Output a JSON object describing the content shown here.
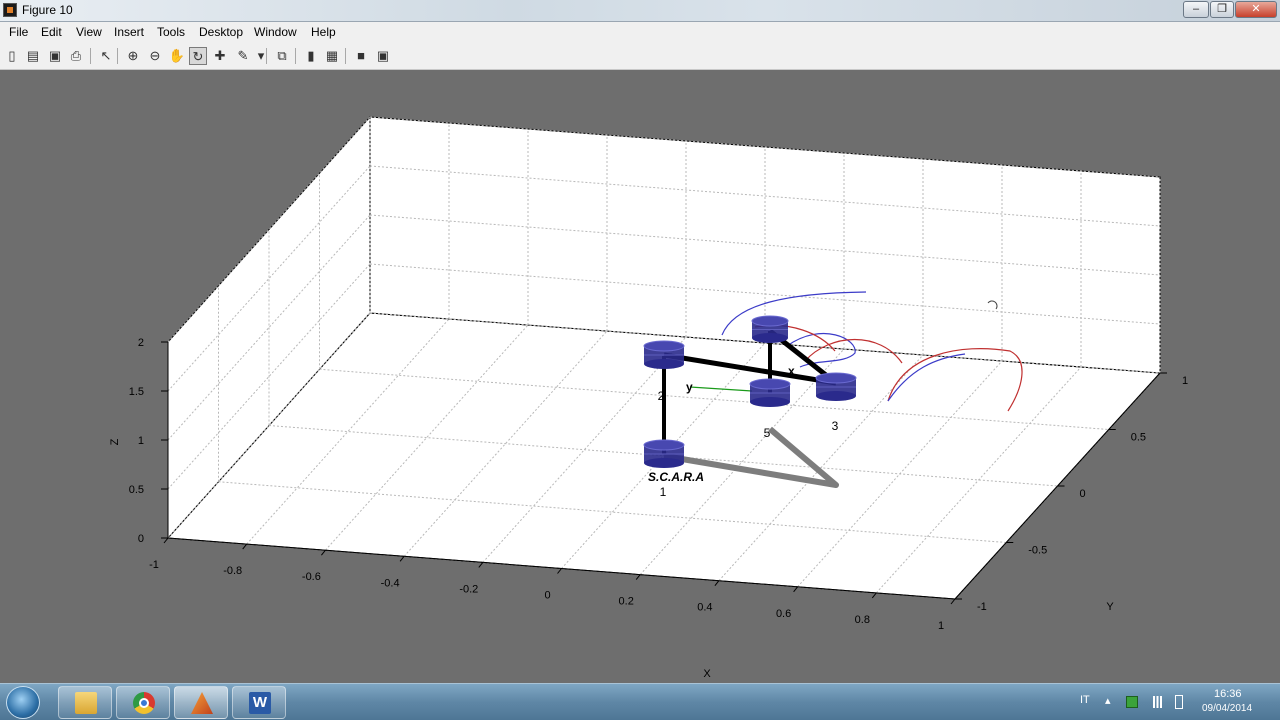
{
  "window": {
    "title": "Figure 10",
    "minimize_glyph": "–",
    "maximize_glyph": "❐",
    "close_glyph": "✕"
  },
  "menu": [
    "File",
    "Edit",
    "View",
    "Insert",
    "Tools",
    "Desktop",
    "Window",
    "Help"
  ],
  "toolbar": [
    {
      "name": "new-figure-icon",
      "glyph": "▯"
    },
    {
      "name": "open-file-icon",
      "glyph": "▤"
    },
    {
      "name": "save-icon",
      "glyph": "▣"
    },
    {
      "name": "print-icon",
      "glyph": "⎙"
    },
    {
      "name": "select-arrow-icon",
      "glyph": "↖"
    },
    {
      "name": "zoom-in-icon",
      "glyph": "⊕"
    },
    {
      "name": "zoom-out-icon",
      "glyph": "⊖"
    },
    {
      "name": "pan-hand-icon",
      "glyph": "✋"
    },
    {
      "name": "rotate-3d-icon",
      "glyph": "↻"
    },
    {
      "name": "data-cursor-icon",
      "glyph": "✚"
    },
    {
      "name": "brush-icon",
      "glyph": "✎"
    },
    {
      "name": "brush-dropdown-icon",
      "glyph": "▾"
    },
    {
      "name": "link-plot-icon",
      "glyph": "⧉"
    },
    {
      "name": "colorbar-icon",
      "glyph": "▮"
    },
    {
      "name": "legend-icon",
      "glyph": "▦"
    },
    {
      "name": "hide-plot-tools-icon",
      "glyph": "■"
    },
    {
      "name": "show-plot-tools-icon",
      "glyph": "▣"
    }
  ],
  "chart_data": {
    "type": "3d-scene",
    "xlabel": "X",
    "ylabel": "Y",
    "zlabel": "Z",
    "xlim": [
      -1,
      1
    ],
    "ylim": [
      -1,
      1
    ],
    "zlim": [
      0,
      2
    ],
    "xticks": [
      "-1",
      "-0.8",
      "-0.6",
      "-0.4",
      "-0.2",
      "0",
      "0.2",
      "0.4",
      "0.6",
      "0.8",
      "1"
    ],
    "yticks": [
      "-1",
      "-0.5",
      "0",
      "0.5",
      "1"
    ],
    "zticks": [
      "0",
      "0.5",
      "1",
      "1.5",
      "2"
    ],
    "grid": true,
    "robot_label": "S.C.A.R.A",
    "joint_labels": [
      "1",
      "2",
      "3",
      "5"
    ],
    "frame_labels": [
      "x",
      "y"
    ],
    "trajectory_colors": {
      "blue": "#3c3cc8",
      "red": "#c03030",
      "frame_x": "#000000",
      "frame_y": "#1a9a1a"
    },
    "joint_color": "#2a2a8c"
  },
  "taskbar": {
    "apps": [
      "windows-explorer",
      "google-chrome",
      "matlab",
      "microsoft-word"
    ],
    "tray": {
      "language": "IT",
      "time": "16:36",
      "date": "09/04/2014",
      "chevron": "▴"
    }
  }
}
